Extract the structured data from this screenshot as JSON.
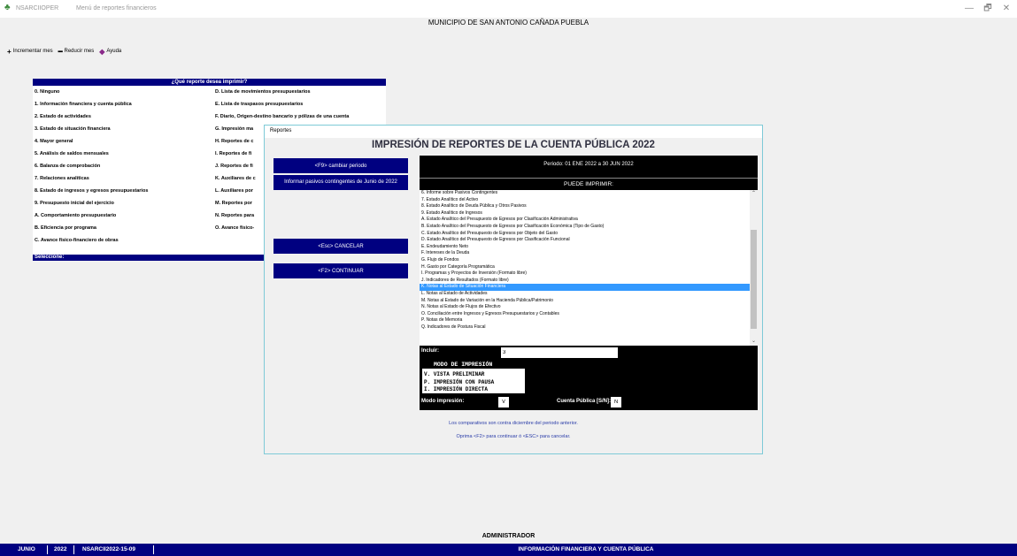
{
  "window": {
    "app_name": "NSARCIIOPER",
    "title": "Menú de reportes financieros",
    "minimize": "—",
    "maximize": "🗗",
    "close": "✕"
  },
  "header": {
    "municipio": "MUNICIPIO DE SAN ANTONIO CAÑADA PUEBLA"
  },
  "toolbar": {
    "increment_label": "Incrementar mes",
    "reduce_label": "Reducir mes",
    "help_label": "Ayuda"
  },
  "menu": {
    "question": "¿Qué reporte desea imprimir?",
    "left_items": [
      "0. Ninguno",
      "1. Información financiera y cuenta pública",
      "2. Estado de actividades",
      "3. Estado de situación financiera",
      "4. Mayor general",
      "5. Análisis de saldos mensuales",
      "6. Balanza de comprobación",
      "7. Relaciones analíticas",
      "8. Estado de ingresos y egresos presupuestarios",
      "9. Presupuesto inicial del ejercicio",
      "A. Comportamiento presupuestario",
      "B. Eficiencia por programa",
      "C. Avance físico-financiero de obras"
    ],
    "right_items": [
      "D. Lista de movimientos presupuestarios",
      "E. Lista de traspasos presupuestarios",
      "F. Diario, Origen-destino bancario y pólizas de una cuenta",
      "G. Impresión ma",
      "H. Reportes de c",
      "I. Reportes de fi",
      "J. Reportes de fi",
      "K. Auxiliares de c",
      "L. Auxiliares por",
      "M. Reportes por",
      "N. Reportes para",
      "O. Avance físico-"
    ],
    "select_label": "Seleccione:"
  },
  "dialog": {
    "title": "Reportes",
    "heading": "IMPRESIÓN DE REPORTES DE LA CUENTA PÚBLICA 2022",
    "btn_periodo": "<F9> cambiar periodo",
    "btn_pasivos": "Informar pasivos contingentes de Junio de 2022",
    "btn_cancelar": "<Esc> CANCELAR",
    "btn_continuar": "<F2> CONTINUAR",
    "periodo": "Periodo: 01 ENE 2022 a 30 JUN 2022",
    "puede_imprimir": "PUEDE IMPRIMIR:",
    "list": [
      "6. Informe sobre Pasivos Contingentes",
      "7. Estado Analítico del Activo",
      "8. Estado Analítico de Deuda Pública y Otros Pasivos",
      "9. Estado Analítico de Ingresos",
      "A. Estado Analítico del Presupuesto de Egresos por Clasificación Administrativa",
      "B. Estado Analítico del Presupuesto de Egresos por Clasificación Económica (Tipo de Gasto)",
      "C. Estado Analítico del Presupuesto de Egresos por Objeto del Gasto",
      "D. Estado Analítico del Presupuesto de Egresos por Clasificación Funcional",
      "E. Endeudamiento Neto",
      "F. Intereses de la Deuda",
      "G. Flujo de Fondos",
      "H. Gasto por Categoría Programática",
      "I. Programas y Proyectos de Inversión (Formato libre)",
      "J. Indicadores de Resultados (Formato libre)",
      "K. Notas al Estado de Situación Financiera",
      "L. Notas al Estado de Actividades",
      "M. Notas al Estado de Variación en la Hacienda Pública/Patrimonio",
      "N. Notas al Estado de Flujos de Efectivo",
      "O. Conciliación entre Ingresos y Egresos Presupuestarios y Contables",
      "P. Notas de Memoria",
      "Q. Indicadores de Postura Fiscal"
    ],
    "selected_index": 14,
    "incluir_label": "Incluir:",
    "incluir_value": "3",
    "modo_title": "MODO DE IMPRESIÓN",
    "modo_options": [
      "V. VISTA PRELIMINAR",
      "P. IMPRESIÓN CON PAUSA",
      "I. IMPRESIÓN DIRECTA"
    ],
    "modo_label": "Modo impresión:",
    "modo_value": "V",
    "cuenta_label": "Cuenta Pública [S/N]:",
    "cuenta_value": "N",
    "note1": "Los comparativos son contra diciembre del periodo anterior.",
    "note2": "Oprima <F2> para continuar ó <ESC> para cancelar."
  },
  "status": {
    "user": "ADMINISTRADOR",
    "mes": "JUNIO",
    "anio": "2022",
    "version": "NSARCII2022-15-09",
    "report": "INFORMACIÓN FINANCIERA Y CUENTA PÚBLICA"
  },
  "colors": {
    "navy": "#000080",
    "selection": "#3399ff",
    "dialog_border": "#7ecad7"
  }
}
